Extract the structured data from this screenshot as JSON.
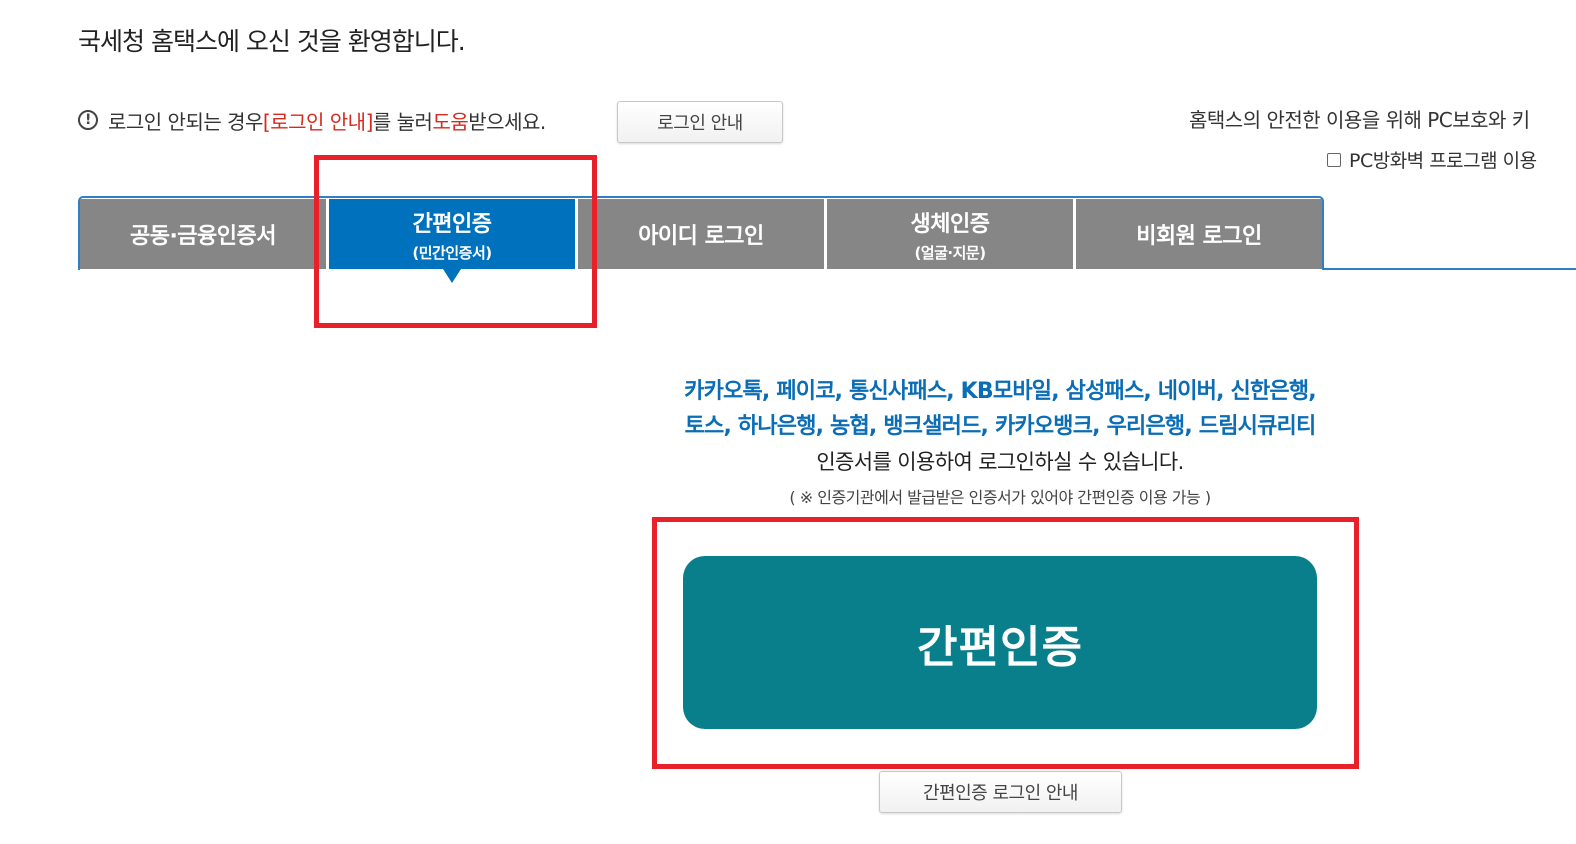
{
  "header": {
    "welcome": "국세청 홈택스에 오신 것을 환영합니다."
  },
  "help": {
    "icon": "exclamation-circle-icon",
    "text_before": "로그인 안되는 경우 ",
    "link_text": "[로그인 안내]",
    "text_middle": "를 눌러 ",
    "help_word": "도움",
    "text_after": "받으세요.",
    "button_label": "로그인 안내"
  },
  "security": {
    "text": "홈택스의 안전한 이용을 위해 PC보호와 키",
    "firewall_label": "PC방화벽 프로그램 이용",
    "firewall_checked": false
  },
  "tabs": [
    {
      "label": "공동·금융인증서",
      "sub": ""
    },
    {
      "label": "간편인증",
      "sub": "(민간인증서)"
    },
    {
      "label": "아이디 로그인",
      "sub": ""
    },
    {
      "label": "생체인증",
      "sub": "(얼굴·지문)"
    },
    {
      "label": "비회원 로그인",
      "sub": ""
    }
  ],
  "active_tab": "간편인증",
  "content": {
    "providers_line1": "카카오톡, 페이코, 통신사패스, KB모바일, 삼성패스, 네이버, 신한은행,",
    "providers_line2": "토스, 하나은행, 농협, 뱅크샐러드, 카카오뱅크, 우리은행, 드림시큐리티",
    "description": "인증서를 이용하여 로그인하실 수 있습니다.",
    "note": "( ※ 인증기관에서 발급받은 인증서가 있어야 간편인증 이용 가능 )",
    "main_button": "간편인증",
    "guide_button": "간편인증 로그인 안내"
  },
  "colors": {
    "tab_active": "#0071bc",
    "tab_inactive": "#868686",
    "provider_text": "#0a6db5",
    "main_button": "#0a7f8c",
    "highlight_box": "#e8202a",
    "help_red": "#d52b1e"
  }
}
